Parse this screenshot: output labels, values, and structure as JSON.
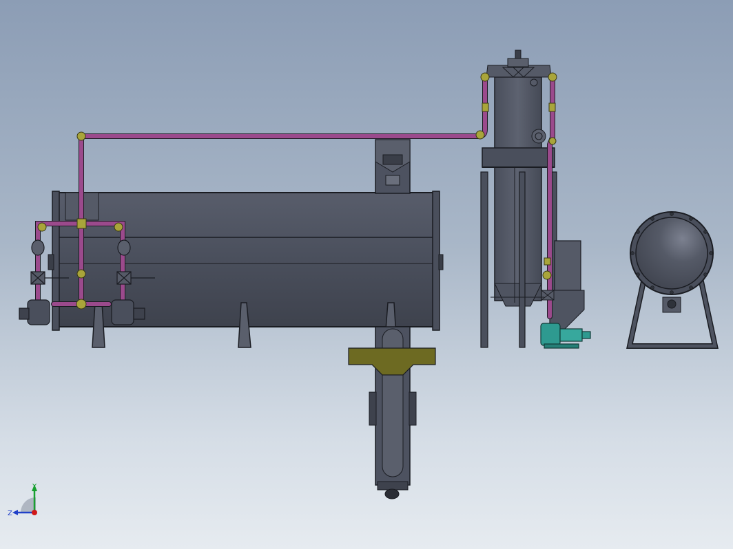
{
  "triad": {
    "x_label": "",
    "y_label": "Y",
    "z_label": "Z"
  },
  "colors": {
    "background_top": "#8c9db5",
    "background_bottom": "#e6ebf0",
    "vessel": "#4c5260",
    "pipe": "#9b4a8c",
    "fitting": "#a9a53a",
    "pump": "#2e9a90",
    "outline": "#1a1c22",
    "axis_x": "#d01818",
    "axis_y": "#18a030",
    "axis_z": "#2040c8"
  }
}
